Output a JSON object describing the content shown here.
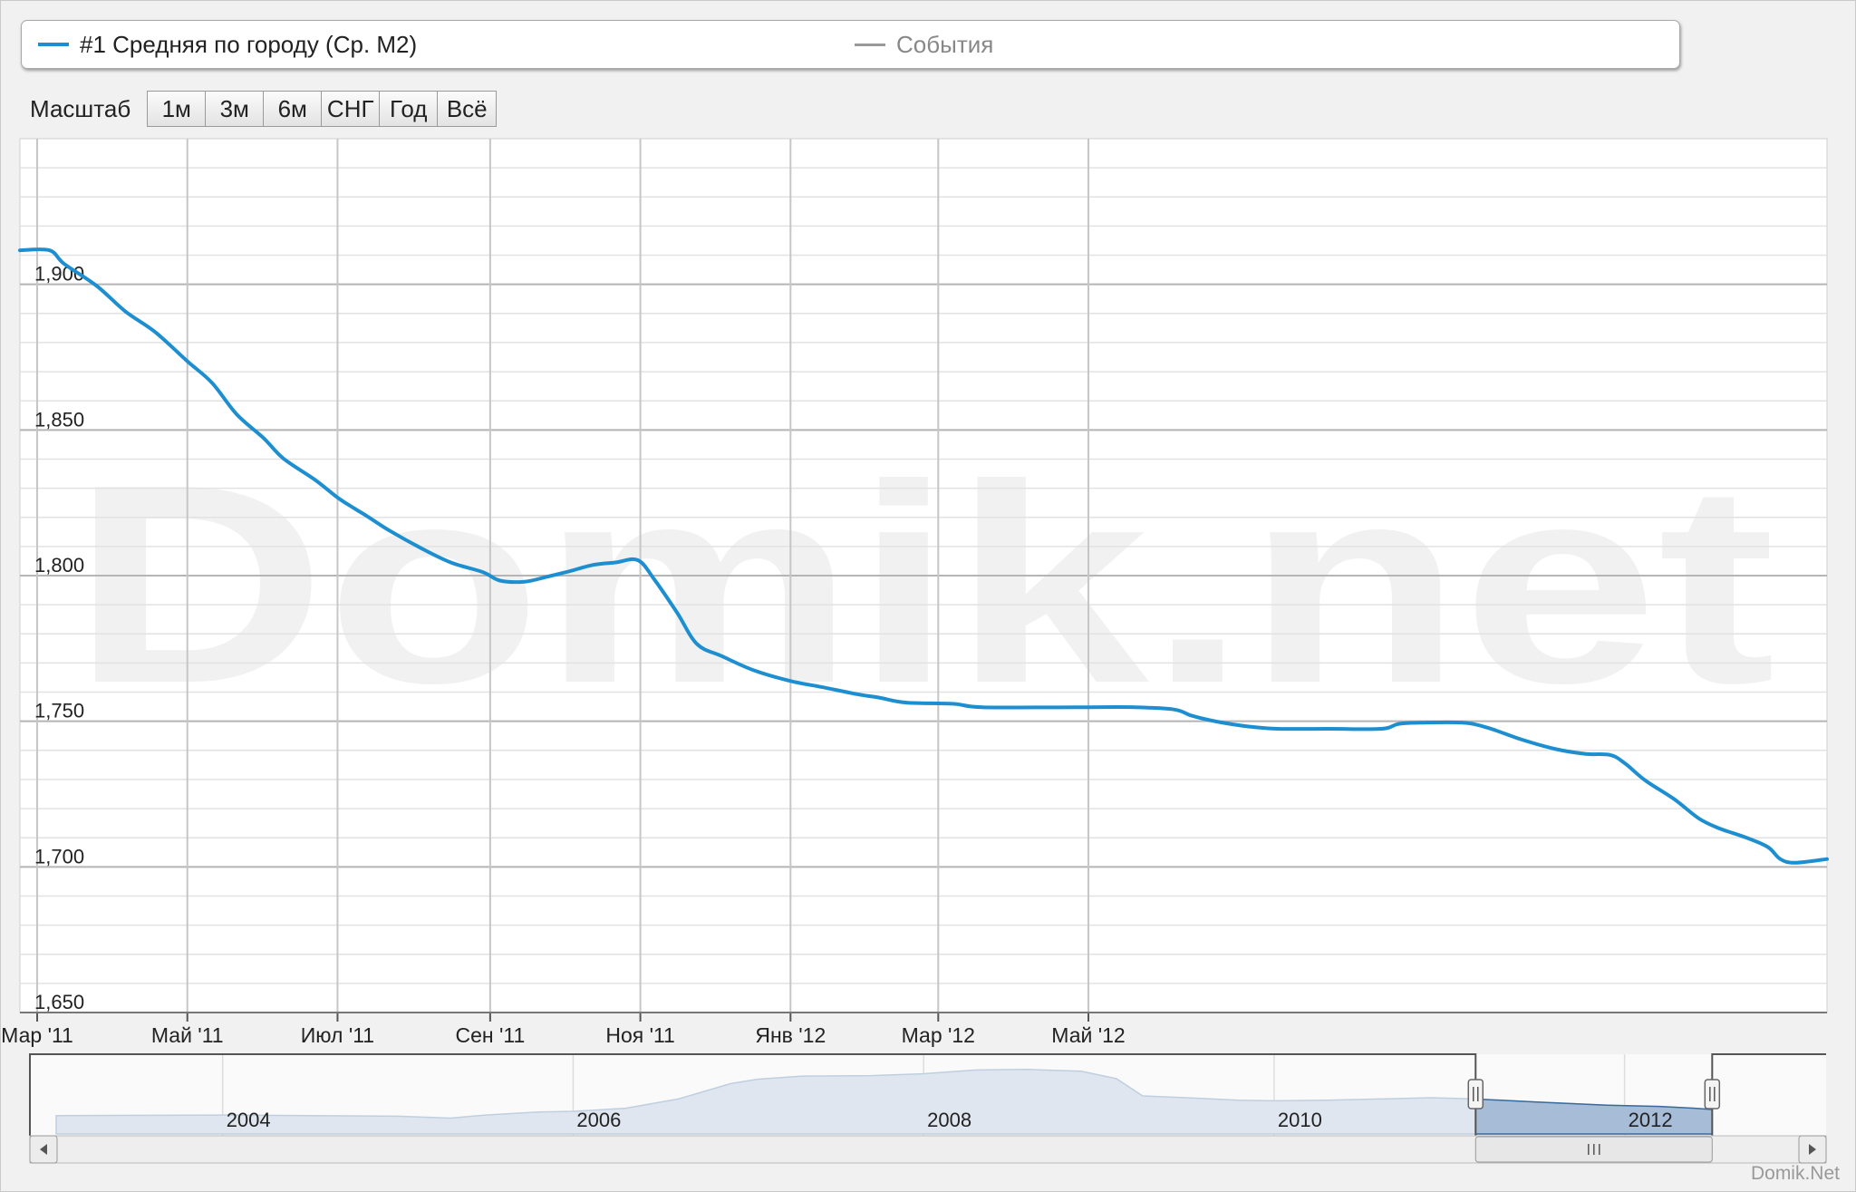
{
  "legend": {
    "series_label": "#1 Средняя по городу (Ср. М2)",
    "events_label": "События"
  },
  "zoom": {
    "label": "Масштаб",
    "buttons": [
      "1м",
      "3м",
      "6м",
      "СНГ",
      "Год",
      "Всё"
    ]
  },
  "watermark": "Domik.net",
  "credit": "Domik.Net",
  "colors": {
    "series": "#1d8fd0",
    "navigator_fill": "#dfe6ef",
    "navigator_selected": "#a7bcd6"
  },
  "chart_data": [
    {
      "type": "line",
      "series": [
        {
          "name": "#1 Средняя по городу (Ср. М2)",
          "points": [
            [
              "2011-02-22",
              1911.7
            ],
            [
              "2011-03-06",
              1911.7
            ],
            [
              "2011-03-12",
              1907
            ],
            [
              "2011-03-25",
              1899.6
            ],
            [
              "2011-04-06",
              1890.6
            ],
            [
              "2011-04-18",
              1883.6
            ],
            [
              "2011-05-01",
              1873.6
            ],
            [
              "2011-05-11",
              1866.2
            ],
            [
              "2011-05-21",
              1855.4
            ],
            [
              "2011-06-01",
              1847.2
            ],
            [
              "2011-06-09",
              1840.2
            ],
            [
              "2011-06-22",
              1832.8
            ],
            [
              "2011-07-02",
              1826.2
            ],
            [
              "2011-07-13",
              1820.4
            ],
            [
              "2011-07-22",
              1815.5
            ],
            [
              "2011-08-04",
              1809.4
            ],
            [
              "2011-08-16",
              1804.5
            ],
            [
              "2011-08-29",
              1801.2
            ],
            [
              "2011-09-05",
              1798.3
            ],
            [
              "2011-09-15",
              1797.9
            ],
            [
              "2011-09-24",
              1799.6
            ],
            [
              "2011-10-02",
              1801.2
            ],
            [
              "2011-10-13",
              1803.7
            ],
            [
              "2011-10-22",
              1804.5
            ],
            [
              "2011-10-31",
              1805.3
            ],
            [
              "2011-11-07",
              1798.3
            ],
            [
              "2011-11-16",
              1787.2
            ],
            [
              "2011-11-24",
              1776.5
            ],
            [
              "2011-12-04",
              1772.4
            ],
            [
              "2011-12-17",
              1767.5
            ],
            [
              "2012-01-01",
              1763.8
            ],
            [
              "2012-01-14",
              1761.7
            ],
            [
              "2012-01-28",
              1759.3
            ],
            [
              "2012-02-06",
              1758.1
            ],
            [
              "2012-02-17",
              1756.4
            ],
            [
              "2012-03-07",
              1756
            ],
            [
              "2012-03-19",
              1754.8
            ],
            [
              "2012-04-26",
              1754.8
            ],
            [
              "2012-05-20",
              1754.8
            ],
            [
              "2012-06-05",
              1754
            ],
            [
              "2012-06-12",
              1751.9
            ],
            [
              "2012-06-22",
              1749.9
            ],
            [
              "2012-07-05",
              1748.2
            ],
            [
              "2012-07-17",
              1747.4
            ],
            [
              "2012-08-07",
              1747.4
            ],
            [
              "2012-08-28",
              1747.4
            ],
            [
              "2012-09-04",
              1749.1
            ],
            [
              "2012-09-13",
              1749.5
            ],
            [
              "2012-09-30",
              1749.5
            ],
            [
              "2012-10-10",
              1747.8
            ],
            [
              "2012-10-24",
              1743.7
            ],
            [
              "2012-11-07",
              1740.4
            ],
            [
              "2012-11-19",
              1738.8
            ],
            [
              "2012-11-29",
              1738.4
            ],
            [
              "2012-12-05",
              1735.5
            ],
            [
              "2012-12-13",
              1729.8
            ],
            [
              "2012-12-25",
              1723.2
            ],
            [
              "2013-01-04",
              1716.6
            ],
            [
              "2013-01-12",
              1713.3
            ],
            [
              "2013-01-23",
              1710.1
            ],
            [
              "2013-02-01",
              1706.8
            ],
            [
              "2013-02-06",
              1702.7
            ],
            [
              "2013-02-12",
              1701.4
            ],
            [
              "2013-02-25",
              1702.7
            ]
          ]
        }
      ],
      "x_tick_labels": [
        "Мар '11",
        "Май '11",
        "Июл '11",
        "Сен '11",
        "Ноя '11",
        "Янв '12",
        "Мар '12",
        "Май '12"
      ],
      "y_tick_labels": [
        "1,650",
        "1,700",
        "1,750",
        "1,800",
        "1,850",
        "1,900"
      ],
      "x_ticks": [
        "2011-03-01",
        "2011-05-01",
        "2011-07-01",
        "2011-09-01",
        "2011-11-01",
        "2012-01-01",
        "2012-03-01",
        "2012-05-01"
      ],
      "y_ticks": [
        1650,
        1700,
        1750,
        1800,
        1850,
        1900
      ],
      "xlim": [
        "2011-02-22",
        "2013-02-25"
      ],
      "ylim": [
        1650,
        1950
      ],
      "grid": true,
      "legend_position": "top"
    },
    {
      "type": "area",
      "role": "navigator",
      "x_tick_labels": [
        "2004",
        "2006",
        "2008",
        "2010",
        "2012"
      ],
      "x_ticks": [
        2004,
        2006,
        2008,
        2010,
        2012
      ],
      "xlim": [
        2002.9,
        2013.15
      ],
      "selected_range": [
        2011.15,
        2012.5
      ],
      "series": [
        {
          "points": [
            [
              2003.05,
              0.18
            ],
            [
              2004.0,
              0.19
            ],
            [
              2004.5,
              0.18
            ],
            [
              2005.0,
              0.17
            ],
            [
              2005.3,
              0.14
            ],
            [
              2005.5,
              0.19
            ],
            [
              2005.8,
              0.24
            ],
            [
              2006.0,
              0.25
            ],
            [
              2006.3,
              0.3
            ],
            [
              2006.6,
              0.45
            ],
            [
              2006.9,
              0.7
            ],
            [
              2007.05,
              0.77
            ],
            [
              2007.3,
              0.82
            ],
            [
              2007.7,
              0.83
            ],
            [
              2008.0,
              0.86
            ],
            [
              2008.3,
              0.92
            ],
            [
              2008.6,
              0.93
            ],
            [
              2008.9,
              0.9
            ],
            [
              2009.1,
              0.78
            ],
            [
              2009.25,
              0.5
            ],
            [
              2009.5,
              0.47
            ],
            [
              2009.8,
              0.43
            ],
            [
              2010.0,
              0.42
            ],
            [
              2010.3,
              0.43
            ],
            [
              2010.6,
              0.45
            ],
            [
              2010.9,
              0.47
            ],
            [
              2011.15,
              0.45
            ],
            [
              2011.5,
              0.4
            ],
            [
              2011.9,
              0.35
            ],
            [
              2012.2,
              0.33
            ],
            [
              2012.4,
              0.3
            ],
            [
              2012.5,
              0.28
            ]
          ]
        }
      ]
    }
  ]
}
